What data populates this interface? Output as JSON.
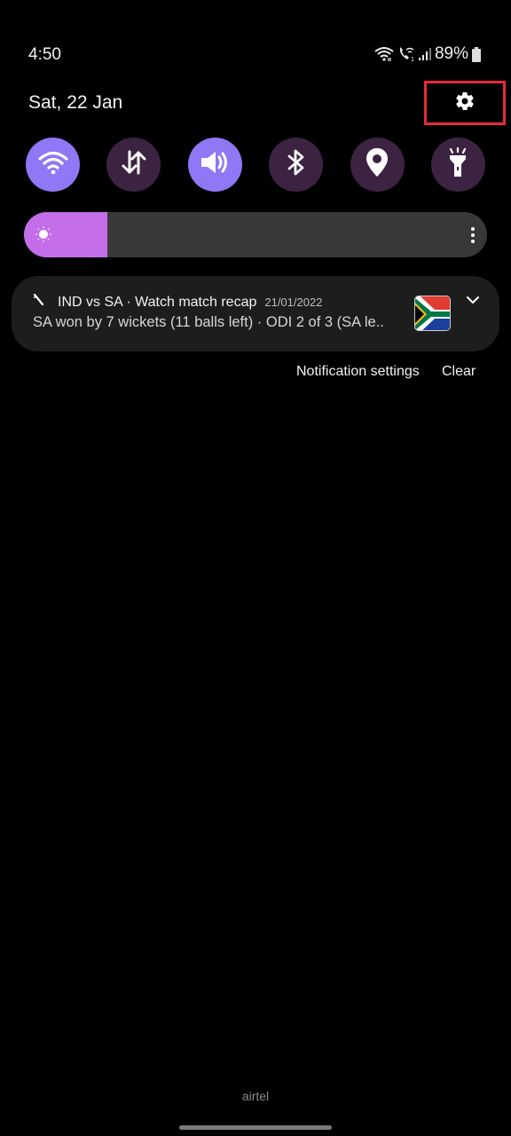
{
  "status_bar": {
    "time": "4:50",
    "battery_percent": "89%",
    "icons": [
      "wifi-icon",
      "wifi-calling-icon",
      "signal-icon",
      "battery-icon"
    ]
  },
  "header": {
    "date": "Sat, 22 Jan",
    "settings_icon": "gear-icon",
    "highlight_color": "#e8283a"
  },
  "quick_tiles": [
    {
      "name": "wifi",
      "icon": "wifi-icon",
      "active": true
    },
    {
      "name": "mobile-data",
      "icon": "data-transfer-icon",
      "active": false
    },
    {
      "name": "sound",
      "icon": "volume-icon",
      "active": true
    },
    {
      "name": "bluetooth",
      "icon": "bluetooth-icon",
      "active": false
    },
    {
      "name": "location",
      "icon": "location-pin-icon",
      "active": false
    },
    {
      "name": "flashlight",
      "icon": "flashlight-icon",
      "active": false
    }
  ],
  "colors": {
    "tile_active": "#8f77f5",
    "tile_inactive": "#3d2342",
    "brightness_fill": "#c36ee8",
    "brightness_track": "#383838",
    "card_bg": "#1d1d1d"
  },
  "brightness": {
    "level_percent": 18,
    "icon": "sun-icon",
    "more_icon": "more-vertical-icon"
  },
  "notification": {
    "app_icon": "cricket-bat-icon",
    "title": "IND vs SA · Watch match recap",
    "date": "21/01/2022",
    "body": "SA won by 7 wickets (11 balls left) · ODI 2 of 3 (SA le..",
    "image": "south-africa-flag",
    "expand_icon": "chevron-down-icon"
  },
  "actions": {
    "settings_label": "Notification settings",
    "clear_label": "Clear"
  },
  "footer": {
    "carrier": "airtel"
  }
}
